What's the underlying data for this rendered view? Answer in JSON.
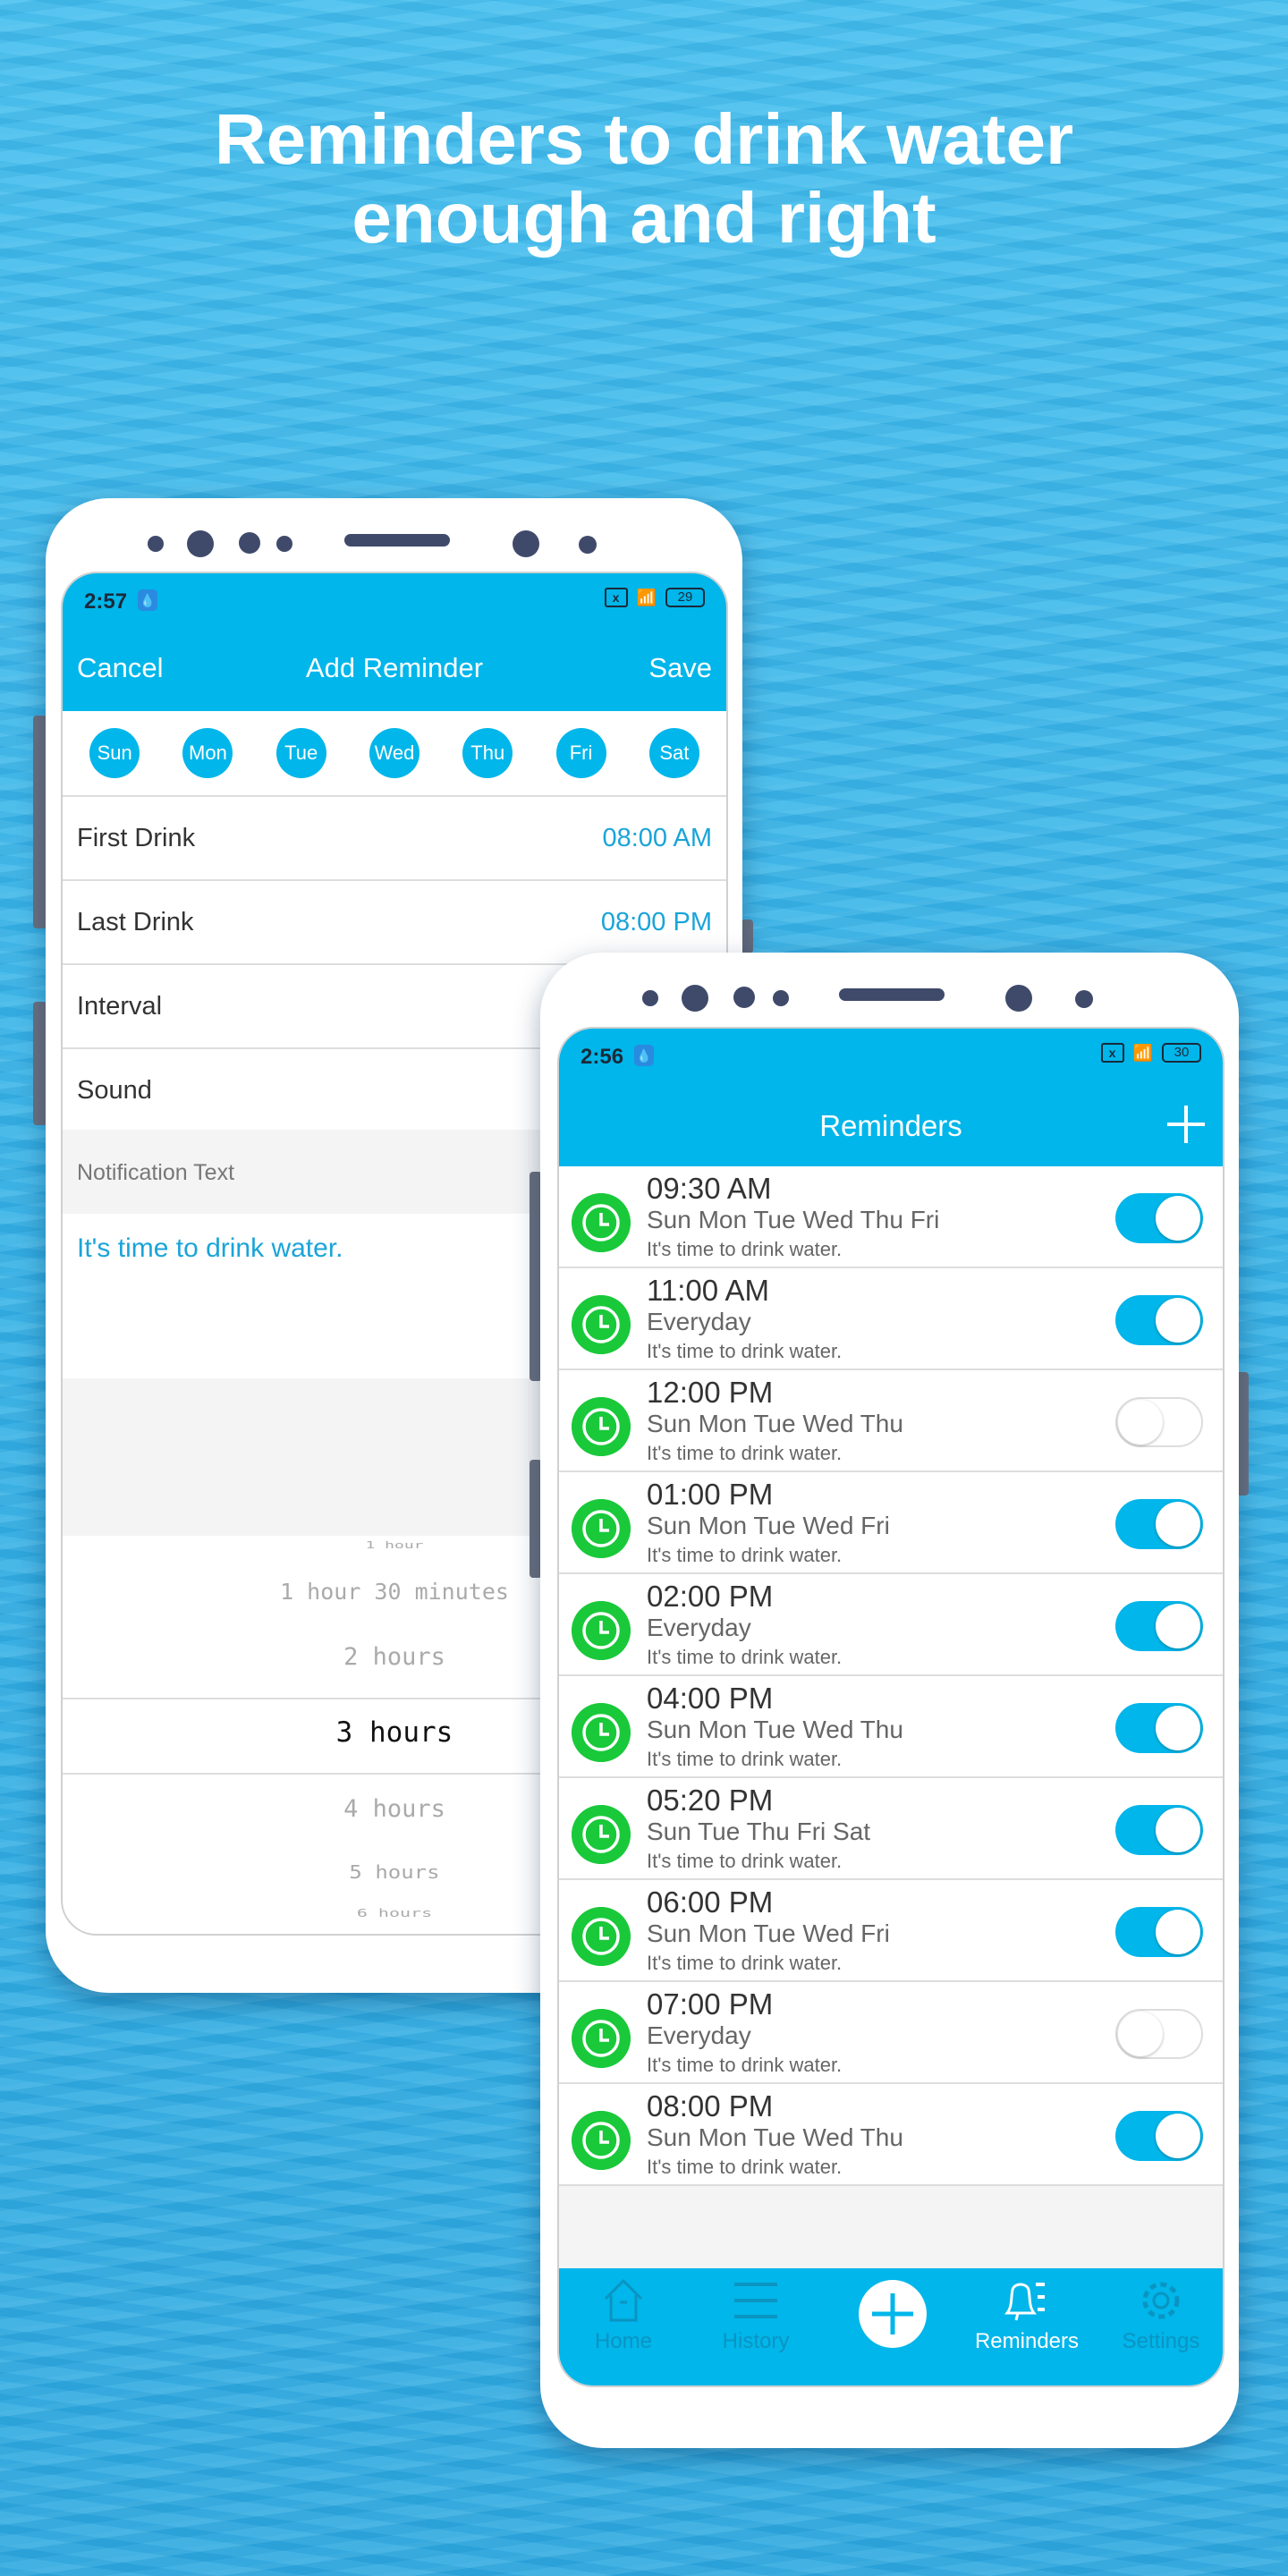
{
  "headline": {
    "line1": "Reminders to drink water",
    "line2": "enough and right"
  },
  "colors": {
    "accent": "#00b6ea",
    "green": "#19c93a",
    "link": "#1aa4d8"
  },
  "add_reminder": {
    "status": {
      "time": "2:57",
      "battery": "29"
    },
    "header": {
      "cancel": "Cancel",
      "title": "Add Reminder",
      "save": "Save"
    },
    "days": [
      "Sun",
      "Mon",
      "Tue",
      "Wed",
      "Thu",
      "Fri",
      "Sat"
    ],
    "rows": [
      {
        "label": "First Drink",
        "value": "08:00 AM"
      },
      {
        "label": "Last Drink",
        "value": "08:00 PM"
      },
      {
        "label": "Interval",
        "value": ""
      },
      {
        "label": "Sound",
        "value": ""
      }
    ],
    "notification_label": "Notification Text",
    "notification_text": "It's time to drink water.",
    "picker": {
      "options": [
        "1 hour",
        "1 hour 30 minutes",
        "2 hours",
        "3 hours",
        "4 hours",
        "5 hours",
        "6 hours"
      ],
      "selected": "3 hours"
    }
  },
  "reminders": {
    "status": {
      "time": "2:56",
      "battery": "30"
    },
    "header": {
      "title": "Reminders",
      "add_icon": "plus-icon"
    },
    "items": [
      {
        "time": "09:30 AM",
        "days": "Sun Mon Tue Wed Thu Fri",
        "message": "It's time to drink water.",
        "enabled": true
      },
      {
        "time": "11:00 AM",
        "days": "Everyday",
        "message": "It's time to drink water.",
        "enabled": true
      },
      {
        "time": "12:00 PM",
        "days": "Sun Mon Tue Wed Thu",
        "message": "It's time to drink water.",
        "enabled": false
      },
      {
        "time": "01:00 PM",
        "days": "Sun Mon Tue Wed Fri",
        "message": "It's time to drink water.",
        "enabled": true
      },
      {
        "time": "02:00 PM",
        "days": "Everyday",
        "message": "It's time to drink water.",
        "enabled": true
      },
      {
        "time": "04:00 PM",
        "days": "Sun Mon Tue Wed Thu",
        "message": "It's time to drink water.",
        "enabled": true
      },
      {
        "time": "05:20 PM",
        "days": "Sun Tue Thu Fri Sat",
        "message": "It's time to drink water.",
        "enabled": true
      },
      {
        "time": "06:00 PM",
        "days": "Sun Mon Tue Wed Fri",
        "message": "It's time to drink water.",
        "enabled": true
      },
      {
        "time": "07:00 PM",
        "days": "Everyday",
        "message": "It's time to drink water.",
        "enabled": false
      },
      {
        "time": "08:00 PM",
        "days": "Sun Mon Tue Wed Thu",
        "message": "It's time to drink water.",
        "enabled": true
      }
    ],
    "tabs": [
      {
        "label": "Home",
        "icon": "home-icon"
      },
      {
        "label": "History",
        "icon": "list-icon"
      },
      {
        "label": "",
        "icon": "add-circle-icon"
      },
      {
        "label": "Reminders",
        "icon": "bell-icon",
        "active": true
      },
      {
        "label": "Settings",
        "icon": "gear-icon"
      }
    ]
  }
}
